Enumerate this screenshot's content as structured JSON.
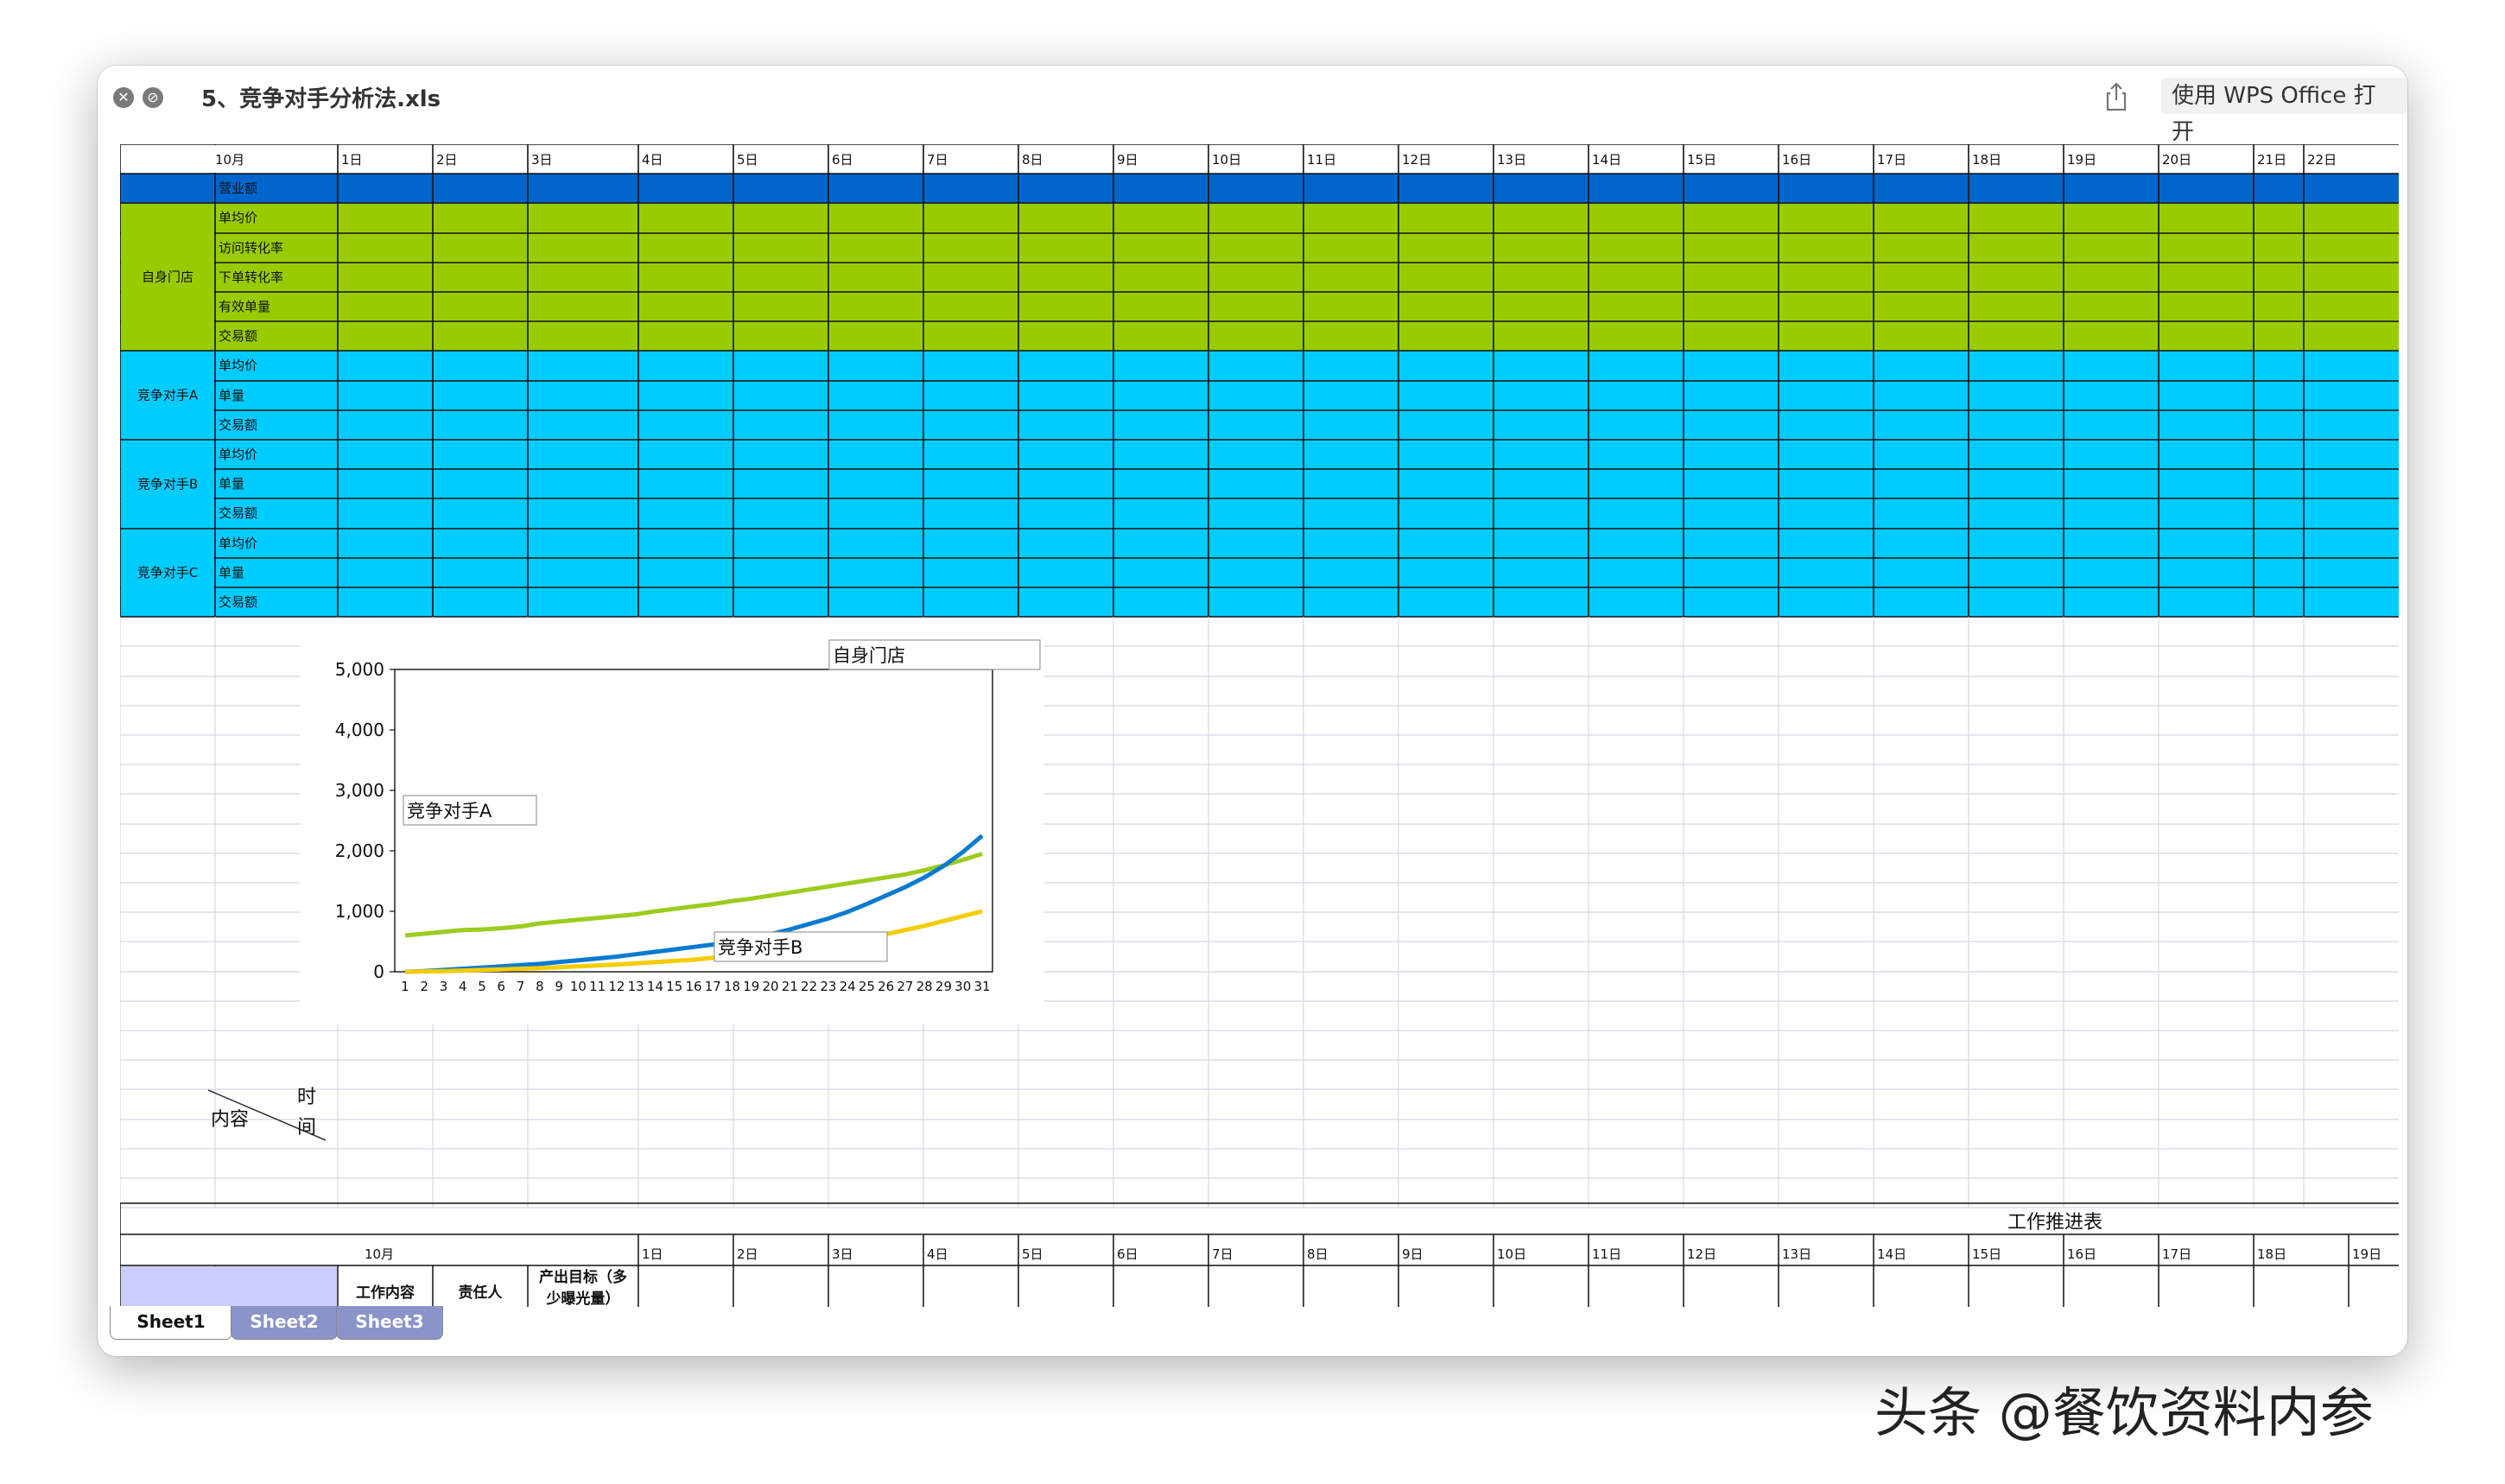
{
  "window": {
    "title": "5、竞争对手分析法.xls",
    "open_with_label": "使用 WPS Office 打开"
  },
  "sheet": {
    "month_label": "10月",
    "days": [
      "1日",
      "2日",
      "3日",
      "4日",
      "5日",
      "6日",
      "7日",
      "8日",
      "9日",
      "10日",
      "11日",
      "12日",
      "13日",
      "14日",
      "15日",
      "16日",
      "17日",
      "18日",
      "19日",
      "20日",
      "21日",
      "22日"
    ],
    "revenue_label": "营业额",
    "groups": [
      {
        "name": "自身门店",
        "color": "#99cc00",
        "metrics": [
          "单均价",
          "访问转化率",
          "下单转化率",
          "有效单量",
          "交易额"
        ]
      },
      {
        "name": "竞争对手A",
        "color": "#00ccff",
        "metrics": [
          "单均价",
          "单量",
          "交易额"
        ]
      },
      {
        "name": "竞争对手B",
        "color": "#00ccff",
        "metrics": [
          "单均价",
          "单量",
          "交易额"
        ]
      },
      {
        "name": "竞争对手C",
        "color": "#00ccff",
        "metrics": [
          "单均价",
          "单量",
          "交易额"
        ]
      }
    ],
    "header_color": "#0066cc",
    "diag_content": "内容",
    "diag_time": "时间",
    "work_table": {
      "title": "工作推进表",
      "month_label": "10月",
      "days": [
        "1日",
        "2日",
        "3日",
        "4日",
        "5日",
        "6日",
        "7日",
        "8日",
        "9日",
        "10日",
        "11日",
        "12日",
        "13日",
        "14日",
        "15日",
        "16日",
        "17日",
        "18日",
        "19日"
      ],
      "col_content": "工作内容",
      "col_owner": "责任人",
      "col_target": "产出目标（多少曝光量）"
    }
  },
  "chart_data": {
    "type": "line",
    "x": [
      1,
      2,
      3,
      4,
      5,
      6,
      7,
      8,
      9,
      10,
      11,
      12,
      13,
      14,
      15,
      16,
      17,
      18,
      19,
      20,
      21,
      22,
      23,
      24,
      25,
      26,
      27,
      28,
      29,
      30,
      31
    ],
    "ylim": [
      0,
      5000
    ],
    "yticks": [
      "0",
      "1,000",
      "2,000",
      "3,000",
      "4,000",
      "5,000"
    ],
    "grid": false,
    "series": [
      {
        "name": "自身门店",
        "color": "#9ccc1e",
        "values": [
          600,
          630,
          660,
          690,
          700,
          720,
          750,
          800,
          830,
          860,
          890,
          920,
          950,
          1000,
          1040,
          1080,
          1120,
          1170,
          1210,
          1260,
          1310,
          1360,
          1410,
          1460,
          1510,
          1560,
          1610,
          1680,
          1760,
          1850,
          1950
        ]
      },
      {
        "name": "竞争对手A",
        "color": "#0a7bd0",
        "values": [
          0,
          10,
          30,
          50,
          70,
          90,
          110,
          130,
          160,
          190,
          220,
          250,
          290,
          330,
          370,
          410,
          450,
          500,
          560,
          620,
          700,
          790,
          880,
          990,
          1120,
          1260,
          1400,
          1560,
          1750,
          1980,
          2250
        ]
      },
      {
        "name": "竞争对手B",
        "color": "#f5cc00",
        "values": [
          0,
          5,
          10,
          20,
          30,
          40,
          50,
          60,
          75,
          90,
          105,
          120,
          140,
          160,
          180,
          200,
          230,
          260,
          290,
          320,
          360,
          400,
          450,
          500,
          560,
          620,
          690,
          760,
          840,
          920,
          1000
        ]
      }
    ]
  }
}
